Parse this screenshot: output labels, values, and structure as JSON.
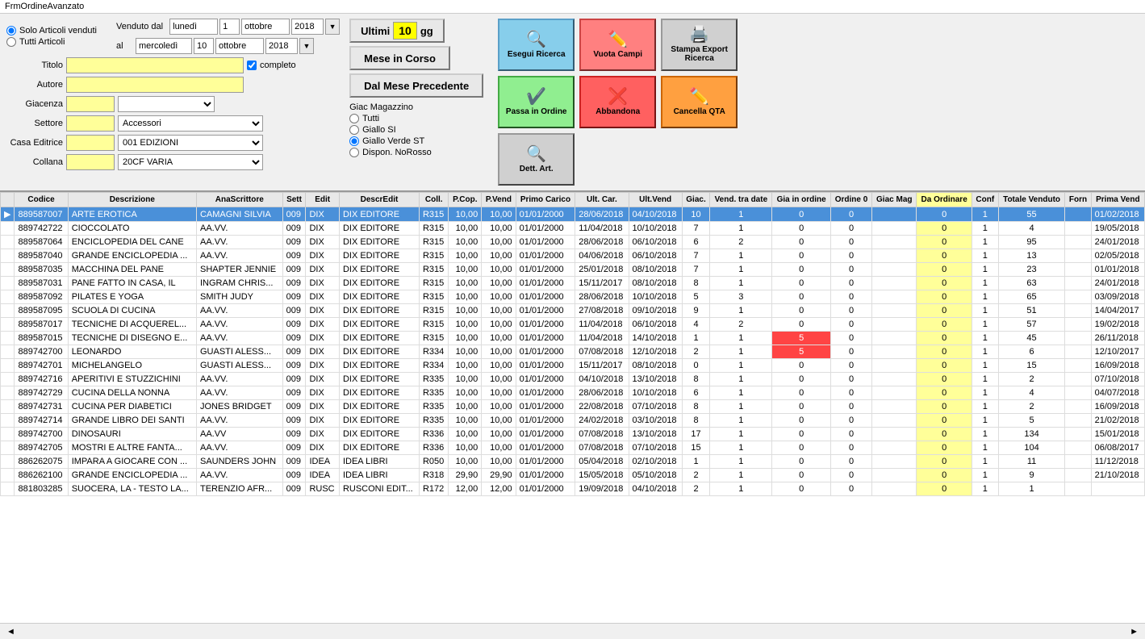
{
  "titlebar": {
    "text": "FrmOrdineAvanzato"
  },
  "filters": {
    "solo_articoli_label": "Solo Articoli venduti",
    "tutti_articoli_label": "Tutti Articoli",
    "venduto_dal_label": "Venduto dal",
    "al_label": "al",
    "date_from": {
      "day": "1",
      "month": "ottobre",
      "year": "2018",
      "weekday": "lunedì"
    },
    "date_to": {
      "day": "10",
      "month": "ottobre",
      "year": "2018",
      "weekday": "mercoledì"
    },
    "titolo_label": "Titolo",
    "autore_label": "Autore",
    "giacenza_label": "Giacenza",
    "completo_label": "completo",
    "settore_label": "Settore",
    "settore_value": "Accessori",
    "casa_editrice_label": "Casa Editrice",
    "casa_editrice_value": "001 EDIZIONI",
    "collana_label": "Collana",
    "collana_value": "20CF VARIA"
  },
  "middle_buttons": {
    "ultimi_label": "Ultimi",
    "ultimi_num": "10",
    "gg_label": "gg",
    "mese_label": "Mese in Corso",
    "dal_mese_label": "Dal Mese Precedente",
    "giac_mag_label": "Giac Magazzino",
    "tutti_label": "Tutti",
    "giallo_si_label": "Giallo SI",
    "giallo_verde_label": "Giallo Verde ST",
    "dispon_label": "Dispon. NoRosso"
  },
  "action_buttons": {
    "esegui_label": "Esegui Ricerca",
    "vuota_label": "Vuota Campi",
    "stampa_label": "Stampa Export Ricerca",
    "passa_label": "Passa in Ordine",
    "abbandona_label": "Abbandona",
    "cancella_label": "Cancella QTA",
    "dett_label": "Dett. Art."
  },
  "table": {
    "headers": [
      "Codice",
      "Descrizione",
      "AnaScrittore",
      "Sett",
      "Edit",
      "DescrEdit",
      "Coll.",
      "P.Cop.",
      "P.Vend",
      "Primo Carico",
      "Ult. Car.",
      "Ult.Vend",
      "Giac.",
      "Vend. tra date",
      "Gia in ordine",
      "Ordine 0",
      "Giac Mag",
      "Da Ordinare",
      "Conf",
      "Totale Venduto",
      "Forn",
      "Prima Vend"
    ],
    "rows": [
      {
        "selected": true,
        "arrow": "▶",
        "codice": "889587007",
        "descrizione": "ARTE EROTICA",
        "scrittore": "CAMAGNI SILVIA",
        "sett": "009",
        "edit": "DIX",
        "descr_edit": "DIX EDITORE",
        "coll": "R315",
        "pcop": "10,00",
        "pvend": "10,00",
        "primo_carico": "01/01/2000",
        "ult_car": "28/06/2018",
        "ult_vend": "04/10/2018",
        "giac": "10",
        "vend_tra": "1",
        "gia_ord": "0",
        "ordine0": "0",
        "giac_mag": "",
        "da_ord": "0",
        "conf": "1",
        "tot_vend": "55",
        "forn": "",
        "prima_vend": "01/02/2018"
      },
      {
        "selected": false,
        "arrow": "",
        "codice": "889742722",
        "descrizione": "CIOCCOLATO",
        "scrittore": "AA.VV.",
        "sett": "009",
        "edit": "DIX",
        "descr_edit": "DIX EDITORE",
        "coll": "R315",
        "pcop": "10,00",
        "pvend": "10,00",
        "primo_carico": "01/01/2000",
        "ult_car": "11/04/2018",
        "ult_vend": "10/10/2018",
        "giac": "7",
        "vend_tra": "1",
        "gia_ord": "0",
        "ordine0": "0",
        "giac_mag": "",
        "da_ord": "0",
        "conf": "1",
        "tot_vend": "4",
        "forn": "",
        "prima_vend": "19/05/2018"
      },
      {
        "selected": false,
        "arrow": "",
        "codice": "889587064",
        "descrizione": "ENCICLOPEDIA DEL CANE",
        "scrittore": "AA.VV.",
        "sett": "009",
        "edit": "DIX",
        "descr_edit": "DIX EDITORE",
        "coll": "R315",
        "pcop": "10,00",
        "pvend": "10,00",
        "primo_carico": "01/01/2000",
        "ult_car": "28/06/2018",
        "ult_vend": "06/10/2018",
        "giac": "6",
        "vend_tra": "2",
        "gia_ord": "0",
        "ordine0": "0",
        "giac_mag": "",
        "da_ord": "0",
        "conf": "1",
        "tot_vend": "95",
        "forn": "",
        "prima_vend": "24/01/2018"
      },
      {
        "selected": false,
        "arrow": "",
        "codice": "889587040",
        "descrizione": "GRANDE ENCICLOPEDIA ...",
        "scrittore": "AA.VV.",
        "sett": "009",
        "edit": "DIX",
        "descr_edit": "DIX EDITORE",
        "coll": "R315",
        "pcop": "10,00",
        "pvend": "10,00",
        "primo_carico": "01/01/2000",
        "ult_car": "04/06/2018",
        "ult_vend": "06/10/2018",
        "giac": "7",
        "vend_tra": "1",
        "gia_ord": "0",
        "ordine0": "0",
        "giac_mag": "",
        "da_ord": "0",
        "conf": "1",
        "tot_vend": "13",
        "forn": "",
        "prima_vend": "02/05/2018"
      },
      {
        "selected": false,
        "arrow": "",
        "codice": "889587035",
        "descrizione": "MACCHINA DEL PANE",
        "scrittore": "SHAPTER JENNIE",
        "sett": "009",
        "edit": "DIX",
        "descr_edit": "DIX EDITORE",
        "coll": "R315",
        "pcop": "10,00",
        "pvend": "10,00",
        "primo_carico": "01/01/2000",
        "ult_car": "25/01/2018",
        "ult_vend": "08/10/2018",
        "giac": "7",
        "vend_tra": "1",
        "gia_ord": "0",
        "ordine0": "0",
        "giac_mag": "",
        "da_ord": "0",
        "conf": "1",
        "tot_vend": "23",
        "forn": "",
        "prima_vend": "01/01/2018"
      },
      {
        "selected": false,
        "arrow": "",
        "codice": "889587031",
        "descrizione": "PANE FATTO IN CASA, IL",
        "scrittore": "INGRAM CHRIS...",
        "sett": "009",
        "edit": "DIX",
        "descr_edit": "DIX EDITORE",
        "coll": "R315",
        "pcop": "10,00",
        "pvend": "10,00",
        "primo_carico": "01/01/2000",
        "ult_car": "15/11/2017",
        "ult_vend": "08/10/2018",
        "giac": "8",
        "vend_tra": "1",
        "gia_ord": "0",
        "ordine0": "0",
        "giac_mag": "",
        "da_ord": "0",
        "conf": "1",
        "tot_vend": "63",
        "forn": "",
        "prima_vend": "24/01/2018"
      },
      {
        "selected": false,
        "arrow": "",
        "codice": "889587092",
        "descrizione": "PILATES E YOGA",
        "scrittore": "SMITH JUDY",
        "sett": "009",
        "edit": "DIX",
        "descr_edit": "DIX EDITORE",
        "coll": "R315",
        "pcop": "10,00",
        "pvend": "10,00",
        "primo_carico": "01/01/2000",
        "ult_car": "28/06/2018",
        "ult_vend": "10/10/2018",
        "giac": "5",
        "vend_tra": "3",
        "gia_ord": "0",
        "ordine0": "0",
        "giac_mag": "",
        "da_ord": "0",
        "conf": "1",
        "tot_vend": "65",
        "forn": "",
        "prima_vend": "03/09/2018"
      },
      {
        "selected": false,
        "arrow": "",
        "codice": "889587095",
        "descrizione": "SCUOLA DI CUCINA",
        "scrittore": "AA.VV.",
        "sett": "009",
        "edit": "DIX",
        "descr_edit": "DIX EDITORE",
        "coll": "R315",
        "pcop": "10,00",
        "pvend": "10,00",
        "primo_carico": "01/01/2000",
        "ult_car": "27/08/2018",
        "ult_vend": "09/10/2018",
        "giac": "9",
        "vend_tra": "1",
        "gia_ord": "0",
        "ordine0": "0",
        "giac_mag": "",
        "da_ord": "0",
        "conf": "1",
        "tot_vend": "51",
        "forn": "",
        "prima_vend": "14/04/2017"
      },
      {
        "selected": false,
        "arrow": "",
        "codice": "889587017",
        "descrizione": "TECNICHE DI ACQUEREL...",
        "scrittore": "AA.VV.",
        "sett": "009",
        "edit": "DIX",
        "descr_edit": "DIX EDITORE",
        "coll": "R315",
        "pcop": "10,00",
        "pvend": "10,00",
        "primo_carico": "01/01/2000",
        "ult_car": "11/04/2018",
        "ult_vend": "06/10/2018",
        "giac": "4",
        "vend_tra": "2",
        "gia_ord": "0",
        "ordine0": "0",
        "giac_mag": "",
        "da_ord": "0",
        "conf": "1",
        "tot_vend": "57",
        "forn": "",
        "prima_vend": "19/02/2018"
      },
      {
        "selected": false,
        "arrow": "",
        "codice": "889587015",
        "descrizione": "TECNICHE DI DISEGNO E...",
        "scrittore": "AA.VV.",
        "sett": "009",
        "edit": "DIX",
        "descr_edit": "DIX EDITORE",
        "coll": "R315",
        "pcop": "10,00",
        "pvend": "10,00",
        "primo_carico": "01/01/2000",
        "ult_car": "11/04/2018",
        "ult_vend": "14/10/2018",
        "giac": "1",
        "vend_tra": "1",
        "gia_ord": "5",
        "ordine0": "0",
        "giac_mag": "",
        "da_ord": "0",
        "conf": "1",
        "tot_vend": "45",
        "forn": "",
        "prima_vend": "26/11/2018"
      },
      {
        "selected": false,
        "arrow": "",
        "codice": "889742700",
        "descrizione": "LEONARDO",
        "scrittore": "GUASTI ALESS...",
        "sett": "009",
        "edit": "DIX",
        "descr_edit": "DIX EDITORE",
        "coll": "R334",
        "pcop": "10,00",
        "pvend": "10,00",
        "primo_carico": "01/01/2000",
        "ult_car": "07/08/2018",
        "ult_vend": "12/10/2018",
        "giac": "2",
        "vend_tra": "1",
        "gia_ord": "5",
        "ordine0": "0",
        "giac_mag": "",
        "da_ord": "0",
        "conf": "1",
        "tot_vend": "6",
        "forn": "",
        "prima_vend": "12/10/2017"
      },
      {
        "selected": false,
        "arrow": "",
        "codice": "889742701",
        "descrizione": "MICHELANGELO",
        "scrittore": "GUASTI ALESS...",
        "sett": "009",
        "edit": "DIX",
        "descr_edit": "DIX EDITORE",
        "coll": "R334",
        "pcop": "10,00",
        "pvend": "10,00",
        "primo_carico": "01/01/2000",
        "ult_car": "15/11/2017",
        "ult_vend": "08/10/2018",
        "giac": "0",
        "vend_tra": "1",
        "gia_ord": "0",
        "ordine0": "0",
        "giac_mag": "",
        "da_ord": "0",
        "conf": "1",
        "tot_vend": "15",
        "forn": "",
        "prima_vend": "16/09/2018"
      },
      {
        "selected": false,
        "arrow": "",
        "codice": "889742716",
        "descrizione": "APERITIVI E STUZZICHINI",
        "scrittore": "AA.VV.",
        "sett": "009",
        "edit": "DIX",
        "descr_edit": "DIX EDITORE",
        "coll": "R335",
        "pcop": "10,00",
        "pvend": "10,00",
        "primo_carico": "01/01/2000",
        "ult_car": "04/10/2018",
        "ult_vend": "13/10/2018",
        "giac": "8",
        "vend_tra": "1",
        "gia_ord": "0",
        "ordine0": "0",
        "giac_mag": "",
        "da_ord": "0",
        "conf": "1",
        "tot_vend": "2",
        "forn": "",
        "prima_vend": "07/10/2018"
      },
      {
        "selected": false,
        "arrow": "",
        "codice": "889742729",
        "descrizione": "CUCINA DELLA NONNA",
        "scrittore": "AA.VV.",
        "sett": "009",
        "edit": "DIX",
        "descr_edit": "DIX EDITORE",
        "coll": "R335",
        "pcop": "10,00",
        "pvend": "10,00",
        "primo_carico": "01/01/2000",
        "ult_car": "28/06/2018",
        "ult_vend": "10/10/2018",
        "giac": "6",
        "vend_tra": "1",
        "gia_ord": "0",
        "ordine0": "0",
        "giac_mag": "",
        "da_ord": "0",
        "conf": "1",
        "tot_vend": "4",
        "forn": "",
        "prima_vend": "04/07/2018"
      },
      {
        "selected": false,
        "arrow": "",
        "codice": "889742731",
        "descrizione": "CUCINA PER DIABETICI",
        "scrittore": "JONES BRIDGET",
        "sett": "009",
        "edit": "DIX",
        "descr_edit": "DIX EDITORE",
        "coll": "R335",
        "pcop": "10,00",
        "pvend": "10,00",
        "primo_carico": "01/01/2000",
        "ult_car": "22/08/2018",
        "ult_vend": "07/10/2018",
        "giac": "8",
        "vend_tra": "1",
        "gia_ord": "0",
        "ordine0": "0",
        "giac_mag": "",
        "da_ord": "0",
        "conf": "1",
        "tot_vend": "2",
        "forn": "",
        "prima_vend": "16/09/2018"
      },
      {
        "selected": false,
        "arrow": "",
        "codice": "889742714",
        "descrizione": "GRANDE LIBRO DEI SANTI",
        "scrittore": "AA.VV.",
        "sett": "009",
        "edit": "DIX",
        "descr_edit": "DIX EDITORE",
        "coll": "R335",
        "pcop": "10,00",
        "pvend": "10,00",
        "primo_carico": "01/01/2000",
        "ult_car": "24/02/2018",
        "ult_vend": "03/10/2018",
        "giac": "8",
        "vend_tra": "1",
        "gia_ord": "0",
        "ordine0": "0",
        "giac_mag": "",
        "da_ord": "0",
        "conf": "1",
        "tot_vend": "5",
        "forn": "",
        "prima_vend": "21/02/2018"
      },
      {
        "selected": false,
        "arrow": "",
        "codice": "889742700",
        "descrizione": "DINOSAURI",
        "scrittore": "AA.VV",
        "sett": "009",
        "edit": "DIX",
        "descr_edit": "DIX EDITORE",
        "coll": "R336",
        "pcop": "10,00",
        "pvend": "10,00",
        "primo_carico": "01/01/2000",
        "ult_car": "07/08/2018",
        "ult_vend": "13/10/2018",
        "giac": "17",
        "vend_tra": "1",
        "gia_ord": "0",
        "ordine0": "0",
        "giac_mag": "",
        "da_ord": "0",
        "conf": "1",
        "tot_vend": "134",
        "forn": "",
        "prima_vend": "15/01/2018"
      },
      {
        "selected": false,
        "arrow": "",
        "codice": "889742705",
        "descrizione": "MOSTRI E ALTRE FANTA...",
        "scrittore": "AA.VV.",
        "sett": "009",
        "edit": "DIX",
        "descr_edit": "DIX EDITORE",
        "coll": "R336",
        "pcop": "10,00",
        "pvend": "10,00",
        "primo_carico": "01/01/2000",
        "ult_car": "07/08/2018",
        "ult_vend": "07/10/2018",
        "giac": "15",
        "vend_tra": "1",
        "gia_ord": "0",
        "ordine0": "0",
        "giac_mag": "",
        "da_ord": "0",
        "conf": "1",
        "tot_vend": "104",
        "forn": "",
        "prima_vend": "06/08/2017"
      },
      {
        "selected": false,
        "arrow": "",
        "codice": "886262075",
        "descrizione": "IMPARA A GIOCARE CON ...",
        "scrittore": "SAUNDERS JOHN",
        "sett": "009",
        "edit": "IDEA",
        "descr_edit": "IDEA LIBRI",
        "coll": "R050",
        "pcop": "10,00",
        "pvend": "10,00",
        "primo_carico": "01/01/2000",
        "ult_car": "05/04/2018",
        "ult_vend": "02/10/2018",
        "giac": "1",
        "vend_tra": "1",
        "gia_ord": "0",
        "ordine0": "0",
        "giac_mag": "",
        "da_ord": "0",
        "conf": "1",
        "tot_vend": "11",
        "forn": "",
        "prima_vend": "11/12/2018"
      },
      {
        "selected": false,
        "arrow": "",
        "codice": "886262100",
        "descrizione": "GRANDE ENCICLOPEDIA ...",
        "scrittore": "AA.VV.",
        "sett": "009",
        "edit": "IDEA",
        "descr_edit": "IDEA LIBRI",
        "coll": "R318",
        "pcop": "29,90",
        "pvend": "29,90",
        "primo_carico": "01/01/2000",
        "ult_car": "15/05/2018",
        "ult_vend": "05/10/2018",
        "giac": "2",
        "vend_tra": "1",
        "gia_ord": "0",
        "ordine0": "0",
        "giac_mag": "",
        "da_ord": "0",
        "conf": "1",
        "tot_vend": "9",
        "forn": "",
        "prima_vend": "21/10/2018"
      },
      {
        "selected": false,
        "arrow": "",
        "codice": "881803285",
        "descrizione": "SUOCERA, LA - TESTO LA...",
        "scrittore": "TERENZIO AFR...",
        "sett": "009",
        "edit": "RUSC",
        "descr_edit": "RUSCONI EDIT...",
        "coll": "R172",
        "pcop": "12,00",
        "pvend": "12,00",
        "primo_carico": "01/01/2000",
        "ult_car": "19/09/2018",
        "ult_vend": "04/10/2018",
        "giac": "2",
        "vend_tra": "1",
        "gia_ord": "0",
        "ordine0": "0",
        "giac_mag": "",
        "da_ord": "0",
        "conf": "1",
        "tot_vend": "1",
        "forn": "",
        "prima_vend": ""
      }
    ]
  }
}
